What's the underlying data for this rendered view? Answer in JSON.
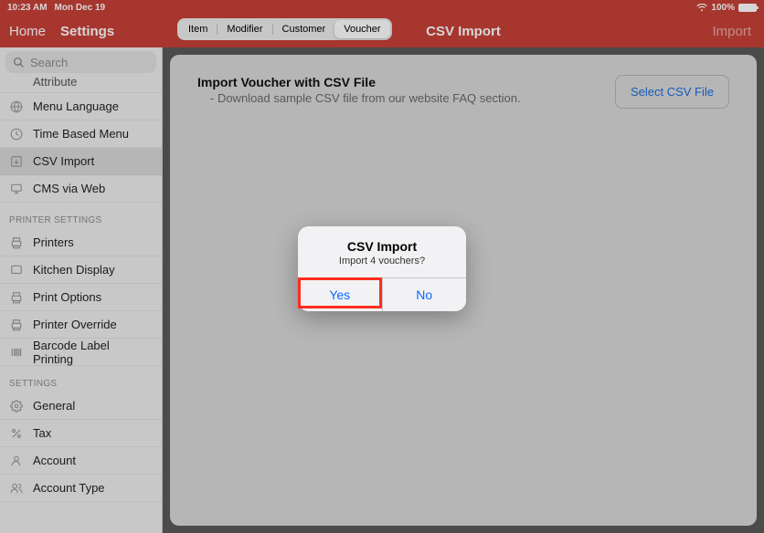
{
  "status": {
    "time": "10:23 AM",
    "date": "Mon Dec 19",
    "battery_pct": "100%"
  },
  "topbar": {
    "home": "Home",
    "settings": "Settings",
    "title": "CSV Import",
    "import_action": "Import",
    "segments": {
      "item": "Item",
      "modifier": "Modifier",
      "customer": "Customer",
      "voucher": "Voucher"
    }
  },
  "search": {
    "placeholder": "Search"
  },
  "sidebar": {
    "clipped_item": "Attribute",
    "items": {
      "menu_language": "Menu Language",
      "time_based_menu": "Time Based Menu",
      "csv_import": "CSV Import",
      "cms_via_web": "CMS via Web"
    },
    "printer_header": "PRINTER SETTINGS",
    "printer_items": {
      "printers": "Printers",
      "kitchen_display": "Kitchen Display",
      "print_options": "Print Options",
      "printer_override": "Printer Override",
      "barcode_label": "Barcode Label Printing"
    },
    "settings_header": "SETTINGS",
    "settings_items": {
      "general": "General",
      "tax": "Tax",
      "account": "Account",
      "account_type": "Account Type"
    }
  },
  "content": {
    "heading": "Import Voucher with CSV File",
    "subtext": "- Download sample CSV file from our website FAQ section.",
    "select_btn": "Select CSV File"
  },
  "alert": {
    "title": "CSV Import",
    "message": "Import 4 vouchers?",
    "yes": "Yes",
    "no": "No"
  }
}
